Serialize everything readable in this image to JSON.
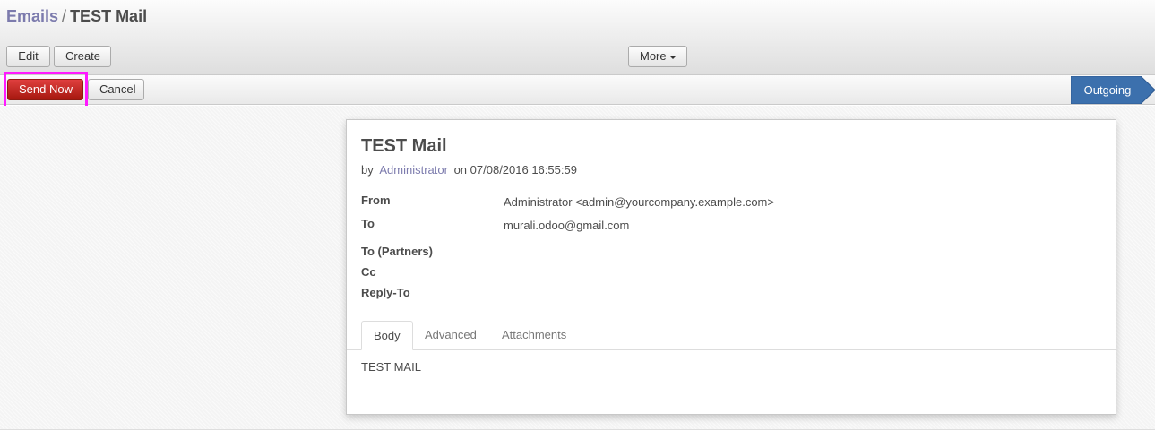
{
  "breadcrumb": {
    "parent": "Emails",
    "separator": "/",
    "current": "TEST Mail"
  },
  "toolbar": {
    "edit_label": "Edit",
    "create_label": "Create",
    "more_label": "More"
  },
  "statusbar": {
    "send_label": "Send Now",
    "cancel_label": "Cancel",
    "stage_label": "Outgoing",
    "stage_color": "#3c70ad",
    "highlight_color": "#ff19ff"
  },
  "mail": {
    "title": "TEST Mail",
    "by_prefix": "by",
    "author": "Administrator",
    "on_prefix": "on",
    "date": "07/08/2016 16:55:59",
    "fields": {
      "from_label": "From",
      "from_value": "Administrator <admin@yourcompany.example.com>",
      "to_label": "To",
      "to_value": "murali.odoo@gmail.com",
      "to_partners_label": "To (Partners)",
      "cc_label": "Cc",
      "reply_to_label": "Reply-To"
    },
    "tabs": [
      "Body",
      "Advanced",
      "Attachments"
    ],
    "active_tab": "Body",
    "body": "TEST MAIL"
  }
}
